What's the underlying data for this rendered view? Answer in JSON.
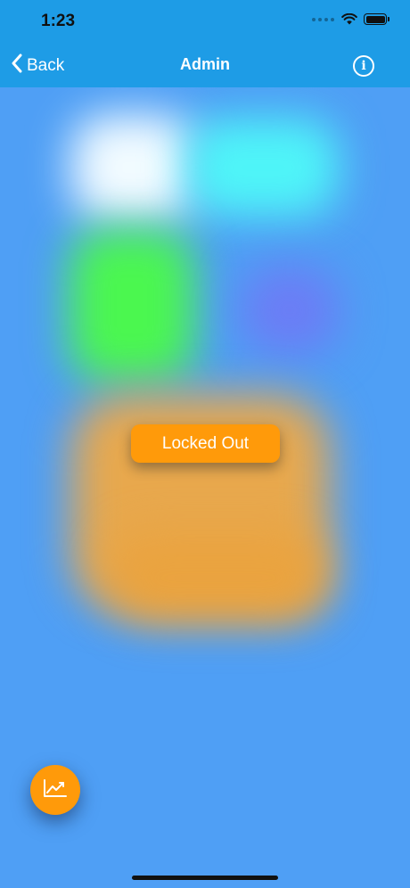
{
  "status_bar": {
    "time": "1:23",
    "signal_icon": "signal-dots-icon",
    "wifi_icon": "wifi-icon",
    "battery_icon": "battery-icon"
  },
  "nav": {
    "back_label": "Back",
    "back_icon": "chevron-left-icon",
    "title": "Admin",
    "info_icon": "info-icon",
    "info_glyph": "i"
  },
  "main": {
    "locked_button_label": "Locked Out",
    "fab_icon": "chart-trend-icon"
  },
  "colors": {
    "header": "#1e9ce6",
    "background": "#4f9ff5",
    "accent_orange": "#ff9a0a",
    "blob_white": "#f2fbff",
    "blob_cyan": "#4ff5f8",
    "blob_green": "#4bf74f",
    "blob_purple": "#6b7df5",
    "blob_orange": "#e8a84d"
  }
}
